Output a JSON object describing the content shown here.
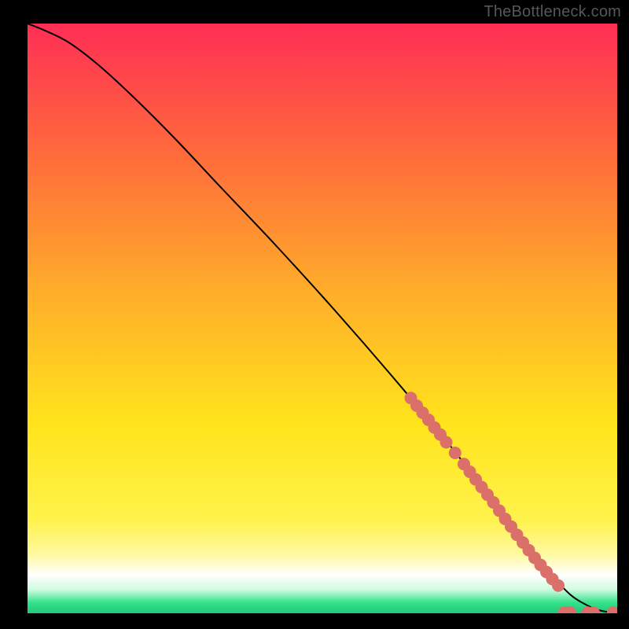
{
  "watermark": "TheBottleneck.com",
  "colors": {
    "top": "#ff2e55",
    "mid_red_orange": "#ff6a3c",
    "mid_orange": "#ffac2a",
    "yellow": "#ffe41c",
    "pale_yellow": "#fff9a0",
    "cream": "#fffde0",
    "white": "#ffffff",
    "mint": "#cffbe0",
    "green": "#33e28a",
    "curve": "#000000",
    "marker": "#da7069",
    "frame": "#000000"
  },
  "chart_data": {
    "type": "line",
    "xlabel": "",
    "ylabel": "",
    "xlim": [
      0,
      100
    ],
    "ylim": [
      0,
      100
    ],
    "title": "",
    "series": [
      {
        "name": "curve",
        "x": [
          0,
          3,
          7,
          12,
          18,
          25,
          33,
          42,
          52,
          62,
          72,
          82,
          88,
          92,
          95,
          97,
          99,
          100
        ],
        "y": [
          100,
          98.8,
          96.8,
          93.0,
          87.5,
          80.5,
          72.0,
          62.5,
          51.5,
          40.0,
          28.0,
          15.0,
          7.5,
          3.2,
          1.3,
          0.5,
          0.15,
          0.1
        ]
      }
    ],
    "markers": [
      {
        "x": 65.0,
        "y": 36.5
      },
      {
        "x": 66.0,
        "y": 35.2
      },
      {
        "x": 67.0,
        "y": 34.0
      },
      {
        "x": 68.0,
        "y": 32.8
      },
      {
        "x": 69.0,
        "y": 31.5
      },
      {
        "x": 70.0,
        "y": 30.3
      },
      {
        "x": 71.0,
        "y": 29.0
      },
      {
        "x": 72.5,
        "y": 27.2
      },
      {
        "x": 74.0,
        "y": 25.3
      },
      {
        "x": 75.0,
        "y": 24.0
      },
      {
        "x": 76.0,
        "y": 22.7
      },
      {
        "x": 77.0,
        "y": 21.4
      },
      {
        "x": 78.0,
        "y": 20.1
      },
      {
        "x": 79.0,
        "y": 18.8
      },
      {
        "x": 80.0,
        "y": 17.4
      },
      {
        "x": 81.0,
        "y": 16.0
      },
      {
        "x": 82.0,
        "y": 14.7
      },
      {
        "x": 83.0,
        "y": 13.3
      },
      {
        "x": 84.0,
        "y": 12.0
      },
      {
        "x": 85.0,
        "y": 10.7
      },
      {
        "x": 86.0,
        "y": 9.4
      },
      {
        "x": 87.0,
        "y": 8.2
      },
      {
        "x": 88.0,
        "y": 7.0
      },
      {
        "x": 89.0,
        "y": 5.8
      },
      {
        "x": 90.0,
        "y": 4.7
      },
      {
        "x": 91.0,
        "y": 0.1
      },
      {
        "x": 92.0,
        "y": 0.1
      },
      {
        "x": 95.0,
        "y": 0.1
      },
      {
        "x": 96.0,
        "y": 0.1
      },
      {
        "x": 99.3,
        "y": 0.1
      }
    ]
  }
}
